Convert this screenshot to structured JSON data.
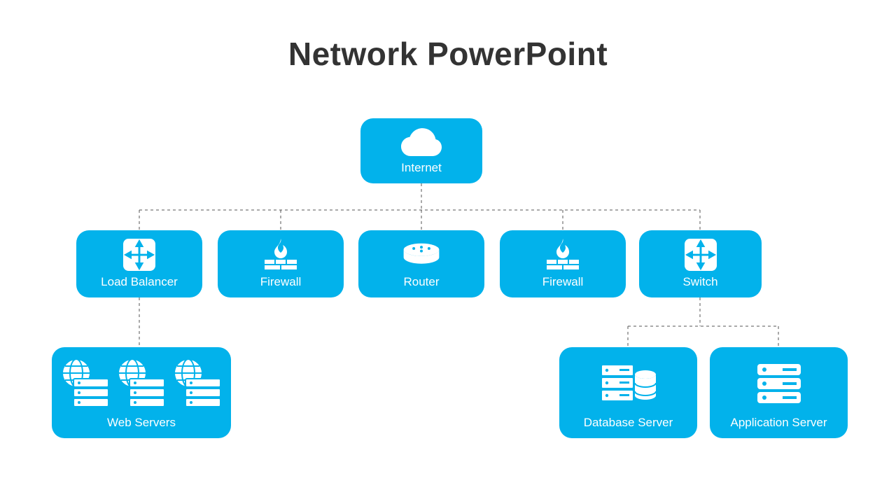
{
  "title": "Network PowerPoint",
  "colors": {
    "node_bg": "#02b2eb",
    "node_fg": "#ffffff",
    "title": "#333333"
  },
  "nodes": {
    "internet": {
      "label": "Internet",
      "icon": "cloud-icon"
    },
    "lb": {
      "label": "Load Balancer",
      "icon": "load-balancer-icon"
    },
    "fw1": {
      "label": "Firewall",
      "icon": "firewall-icon"
    },
    "router": {
      "label": "Router",
      "icon": "router-icon"
    },
    "fw2": {
      "label": "Firewall",
      "icon": "firewall-icon"
    },
    "switch": {
      "label": "Switch",
      "icon": "switch-icon"
    },
    "web": {
      "label": "Web Servers",
      "icon": "web-servers-icon"
    },
    "db": {
      "label": "Database Server",
      "icon": "database-server-icon"
    },
    "app": {
      "label": "Application Server",
      "icon": "application-server-icon"
    }
  },
  "edges": [
    [
      "internet",
      "lb"
    ],
    [
      "internet",
      "fw1"
    ],
    [
      "internet",
      "router"
    ],
    [
      "internet",
      "fw2"
    ],
    [
      "internet",
      "switch"
    ],
    [
      "lb",
      "web"
    ],
    [
      "switch",
      "db"
    ],
    [
      "switch",
      "app"
    ]
  ]
}
